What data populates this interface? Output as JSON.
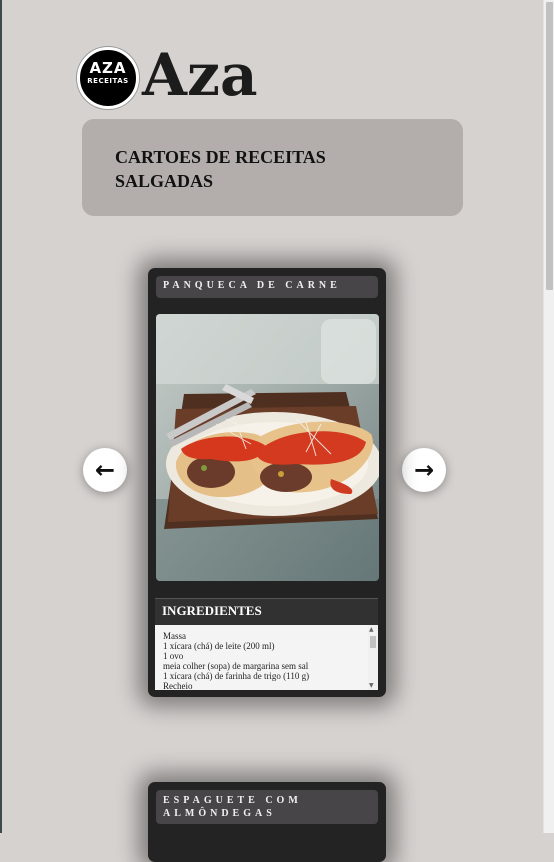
{
  "brand": {
    "logo_line1": "AZA",
    "logo_line2": "RECEITAS",
    "name": "Aza"
  },
  "banner": {
    "title": "CARTOES DE RECEITAS SALGADAS"
  },
  "carousel": {
    "prev_icon": "←",
    "next_icon": "→"
  },
  "recipe_card": {
    "title": "PANQUECA DE CARNE",
    "ingredients_heading": "INGREDIENTES",
    "ingredients": [
      "Massa",
      "1 xícara (chá) de leite (200 ml)",
      "1 ovo",
      "meia colher (sopa) de margarina sem sal",
      "1 xícara (chá) de farinha de trigo (110 g)",
      "Recheio"
    ],
    "scroll_up": "▲",
    "scroll_down": "▼"
  },
  "next_card": {
    "title": "ESPAGUETE COM ALMÔNDEGAS"
  },
  "colors": {
    "background": "#d6d2d0",
    "banner": "#b3aeac",
    "card": "#232323",
    "card_header": "#474547"
  }
}
